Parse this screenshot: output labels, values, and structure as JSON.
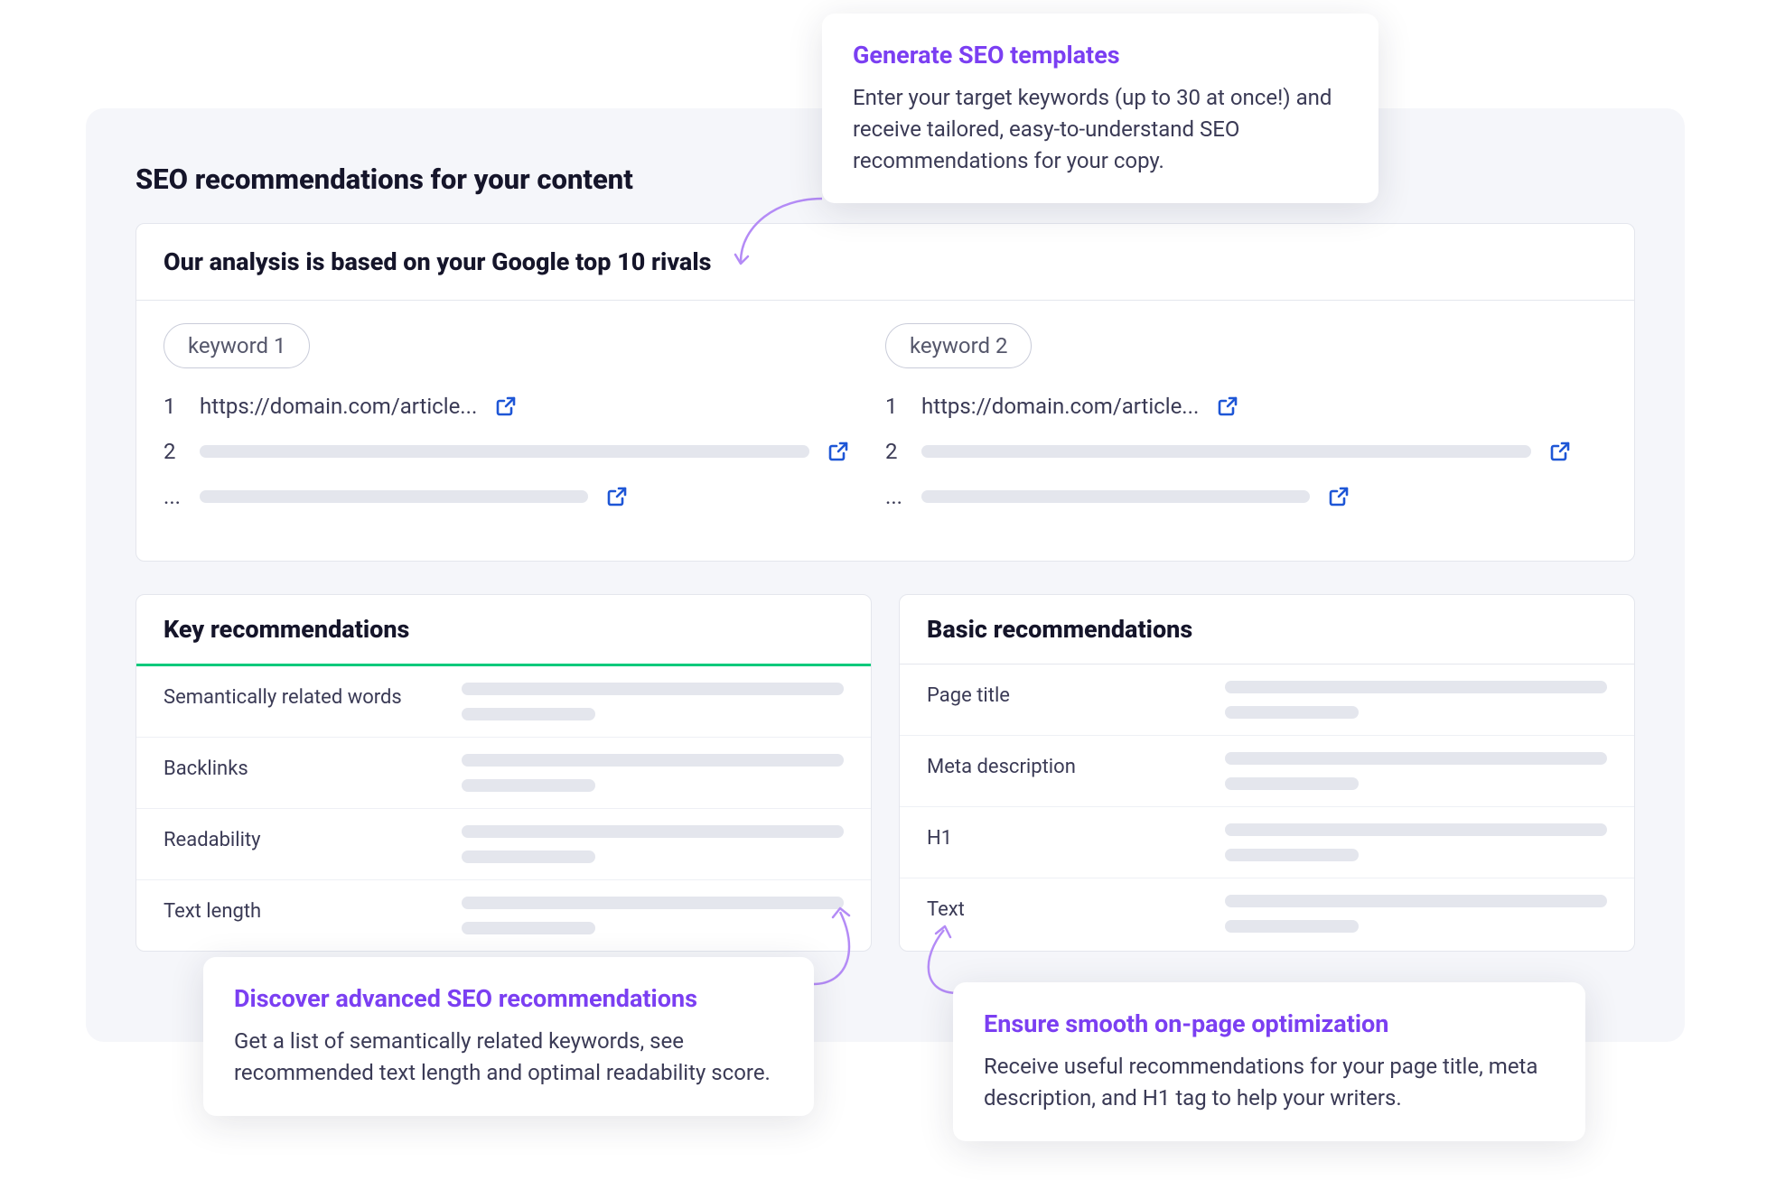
{
  "panel": {
    "title": "SEO recommendations for your content",
    "analysis_header": "Our analysis is based on your Google top 10 rivals",
    "keyword_columns": [
      {
        "label": "keyword 1",
        "rivals": [
          {
            "idx": "1",
            "url": "https://domain.com/article..."
          },
          {
            "idx": "2"
          },
          {
            "idx": "..."
          }
        ]
      },
      {
        "label": "keyword 2",
        "rivals": [
          {
            "idx": "1",
            "url": "https://domain.com/article..."
          },
          {
            "idx": "2"
          },
          {
            "idx": "..."
          }
        ]
      }
    ],
    "key_recs": {
      "header": "Key recommendations",
      "rows": [
        {
          "label": "Semantically related words"
        },
        {
          "label": "Backlinks"
        },
        {
          "label": "Readability"
        },
        {
          "label": "Text length"
        }
      ]
    },
    "basic_recs": {
      "header": "Basic recommendations",
      "rows": [
        {
          "label": "Page title"
        },
        {
          "label": "Meta description"
        },
        {
          "label": "H1"
        },
        {
          "label": "Text"
        }
      ]
    }
  },
  "callouts": {
    "c1": {
      "title": "Generate SEO templates",
      "body": "Enter your target keywords (up to 30 at once!) and receive tailored, easy-to-understand SEO recommendations for your copy."
    },
    "c2": {
      "title": "Discover advanced SEO recommendations",
      "body": "Get a list of semantically related keywords, see recommended text length and optimal readability score."
    },
    "c3": {
      "title": "Ensure smooth on-page optimization",
      "body": "Receive useful recommendations for your page title, meta description, and H1 tag to help your writers."
    }
  }
}
